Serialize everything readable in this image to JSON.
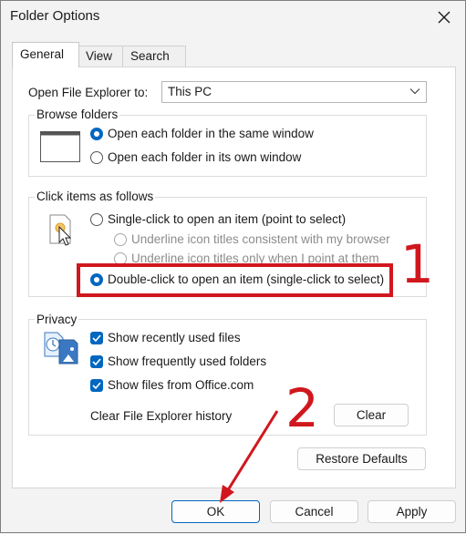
{
  "window": {
    "title": "Folder Options"
  },
  "tabs": [
    {
      "label": "General"
    },
    {
      "label": "View"
    },
    {
      "label": "Search"
    }
  ],
  "open_explorer": {
    "label": "Open File Explorer to:",
    "selected": "This PC"
  },
  "browse_folders": {
    "title": "Browse folders",
    "options": [
      {
        "label": "Open each folder in the same window",
        "selected": true
      },
      {
        "label": "Open each folder in its own window",
        "selected": false
      }
    ]
  },
  "click_items": {
    "title": "Click items as follows",
    "single_click": "Single-click to open an item (point to select)",
    "underline_browser": "Underline icon titles consistent with my browser",
    "underline_point": "Underline icon titles only when I point at them",
    "double_click": "Double-click to open an item (single-click to select)"
  },
  "privacy": {
    "title": "Privacy",
    "checks": [
      {
        "label": "Show recently used files",
        "checked": true
      },
      {
        "label": "Show frequently used folders",
        "checked": true
      },
      {
        "label": "Show files from Office.com",
        "checked": true
      }
    ],
    "clear_history_label": "Clear File Explorer history",
    "clear_button": "Clear"
  },
  "restore_defaults": "Restore Defaults",
  "footer": {
    "ok": "OK",
    "cancel": "Cancel",
    "apply": "Apply"
  },
  "annotations": {
    "step1": "1",
    "step2": "2",
    "color": "#d1171e"
  },
  "colors": {
    "accent": "#0067c0"
  }
}
